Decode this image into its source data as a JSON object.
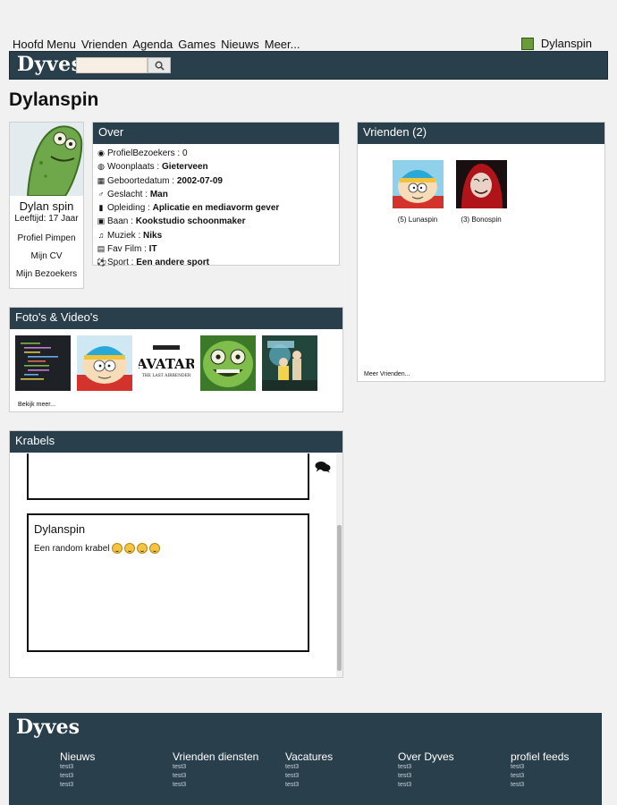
{
  "topnav": {
    "items": [
      "Hoofd Menu",
      "Vrienden",
      "Agenda",
      "Games",
      "Nieuws",
      "Meer..."
    ],
    "username": "Dylanspin"
  },
  "brand": {
    "logo": "Dyves",
    "search_placeholder": "",
    "search_icon": "search-icon"
  },
  "page": {
    "title": "Dylanspin"
  },
  "profile": {
    "name": "Dylan spin",
    "age": "Leeftijd: 17 Jaar",
    "links": [
      "Profiel Pimpen",
      "Mijn CV",
      "Mijn Bezoekers"
    ]
  },
  "over": {
    "title": "Over",
    "rows": [
      {
        "icon": "eye-icon",
        "label": "ProfielBezoekers : ",
        "value": "0"
      },
      {
        "icon": "globe-icon",
        "label": "Woonplaats : ",
        "value": "Gieterveen"
      },
      {
        "icon": "calendar-icon",
        "label": "Geboortedatum : ",
        "value": "2002-07-09"
      },
      {
        "icon": "mars-icon",
        "label": "Geslacht : ",
        "value": "Man"
      },
      {
        "icon": "book-icon",
        "label": "Opleiding : ",
        "value": "Aplicatie en mediavorm gever"
      },
      {
        "icon": "money-icon",
        "label": "Baan : ",
        "value": "Kookstudio schoonmaker"
      },
      {
        "icon": "music-icon",
        "label": "Muziek : ",
        "value": "Niks"
      },
      {
        "icon": "film-icon",
        "label": "Fav Film : ",
        "value": "IT"
      },
      {
        "icon": "soccer-ball-icon",
        "label": "Sport : ",
        "value": "Een andere sport"
      }
    ]
  },
  "vrienden": {
    "title": "Vrienden (2)",
    "friends": [
      {
        "name": "(5) Lunaspin"
      },
      {
        "name": "(3) Bonospin"
      }
    ],
    "more": "Meer Vrienden..."
  },
  "fotos": {
    "title": "Foto's & Video's",
    "more": "Bekijk meer...",
    "avatar_title": "AVATAR",
    "avatar_subtitle": "THE LAST AIRBENDER"
  },
  "krabels": {
    "title": "Krabels",
    "posts": [
      {
        "author": "",
        "text": ""
      },
      {
        "author": "Dylanspin",
        "text": "Een random krabel"
      }
    ]
  },
  "footer": {
    "logo": "Dyves",
    "columns": [
      {
        "title": "Nieuws",
        "links": [
          "test3",
          "test3",
          "test3"
        ]
      },
      {
        "title": "Vrienden diensten",
        "links": [
          "test3",
          "test3",
          "test3"
        ]
      },
      {
        "title": "Vacatures",
        "links": [
          "test3",
          "test3",
          "test3"
        ]
      },
      {
        "title": "Over Dyves",
        "links": [
          "test3",
          "test3",
          "test3"
        ]
      },
      {
        "title": "profiel feeds",
        "links": [
          "test3",
          "test3",
          "test3"
        ]
      }
    ]
  },
  "colors": {
    "header_bg": "#2a3f4c",
    "page_bg": "#f1f1f1"
  }
}
